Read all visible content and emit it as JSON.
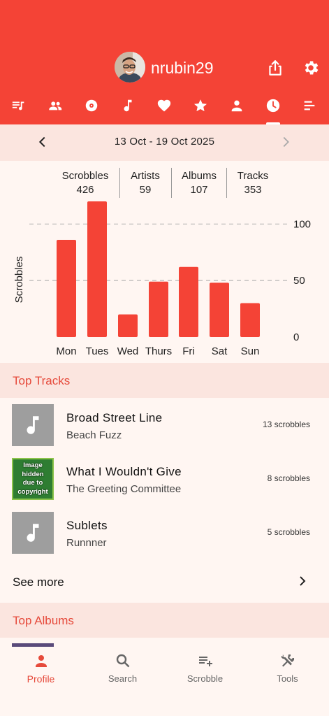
{
  "header": {
    "username": "nrubin29",
    "share_icon": "share-icon",
    "settings_icon": "gear-icon",
    "background": "#f44336"
  },
  "tabs": [
    {
      "icon": "playlist-icon"
    },
    {
      "icon": "people-icon"
    },
    {
      "icon": "album-icon"
    },
    {
      "icon": "music-note-icon"
    },
    {
      "icon": "heart-icon"
    },
    {
      "icon": "star-icon"
    },
    {
      "icon": "person-icon"
    },
    {
      "icon": "clock-icon",
      "selected": true
    },
    {
      "icon": "bar-list-icon"
    }
  ],
  "date_bar": {
    "range": "13 Oct - 19 Oct 2025"
  },
  "stats": [
    {
      "label": "Scrobbles",
      "value": "426"
    },
    {
      "label": "Artists",
      "value": "59"
    },
    {
      "label": "Albums",
      "value": "107"
    },
    {
      "label": "Tracks",
      "value": "353"
    }
  ],
  "chart_data": {
    "type": "bar",
    "categories": [
      "Mon",
      "Tues",
      "Wed",
      "Thurs",
      "Fri",
      "Sat",
      "Sun"
    ],
    "values": [
      86,
      120,
      20,
      49,
      62,
      48,
      30
    ],
    "ylabel": "Scrobbles",
    "yticks": [
      "0",
      "50",
      "100"
    ],
    "ylim": [
      0,
      120
    ],
    "grid": "dashed horizontal at 50 and 100",
    "bar_color": "#f44336"
  },
  "top_tracks": {
    "title": "Top Tracks",
    "items": [
      {
        "title": "Broad Street Line",
        "artist": "Beach Fuzz",
        "count": "13 scrobbles",
        "art": "music-note-icon"
      },
      {
        "title": "What I Wouldn't Give",
        "artist": "The Greeting Committee",
        "count": "8 scrobbles",
        "art_text": [
          "Image",
          "hidden",
          "due to",
          "copyright"
        ]
      },
      {
        "title": "Sublets",
        "artist": "Runnner",
        "count": "5 scrobbles",
        "art": "music-note-icon"
      }
    ],
    "see_more": "See more"
  },
  "top_albums": {
    "title": "Top Albums"
  },
  "bottom_nav": [
    {
      "label": "Profile",
      "icon": "person-icon",
      "active": true
    },
    {
      "label": "Search",
      "icon": "search-icon"
    },
    {
      "label": "Scrobble",
      "icon": "playlist-add-icon"
    },
    {
      "label": "Tools",
      "icon": "tools-icon"
    }
  ],
  "colors": {
    "accent": "#f44336",
    "section_bg": "#fbe5df",
    "page_bg": "#fff6f2"
  }
}
